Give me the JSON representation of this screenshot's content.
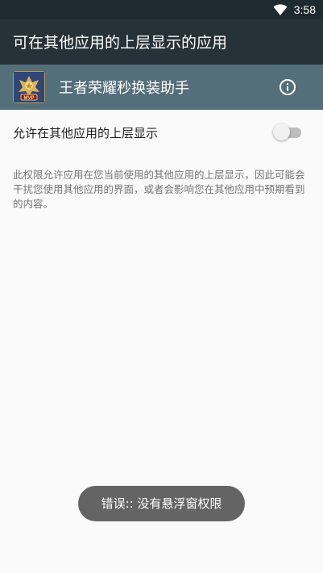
{
  "status_bar": {
    "time": "3:58"
  },
  "toolbar": {
    "title": "可在其他应用的上层显示的应用"
  },
  "app": {
    "name": "王者荣耀秒换装助手",
    "icon_badge": "MVP"
  },
  "setting": {
    "label": "允许在其他应用的上层显示",
    "enabled": false,
    "description": "此权限允许应用在您当前使用的其他应用的上层显示，因此可能会干扰您使用其他应用的界面，或者会影响您在其他应用中预期看到的内容。"
  },
  "toast": {
    "message": "错误:: 没有悬浮窗权限"
  },
  "icons": {
    "wifi": "wifi-icon",
    "info": "info-icon",
    "app": "app-icon"
  },
  "colors": {
    "status_bar": "#1f2930",
    "toolbar": "#263238",
    "app_header": "#546e7a",
    "background": "#fafafa",
    "toast": "#646464"
  }
}
